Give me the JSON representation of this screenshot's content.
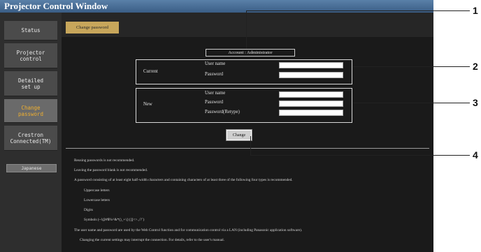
{
  "window": {
    "title": "Projector Control Window"
  },
  "sidebar": {
    "items": [
      {
        "label": "Status"
      },
      {
        "label": "Projector\ncontrol"
      },
      {
        "label": "Detailed\nset up"
      },
      {
        "label": "Change\npassword"
      },
      {
        "label": "Crestron\nConnected(TM)"
      }
    ],
    "language": "Japanese"
  },
  "tabs": {
    "change_password": "Change password"
  },
  "account": {
    "label": "Account : Administrator"
  },
  "current": {
    "label": "Current",
    "user_name_label": "User name",
    "password_label": "Password",
    "user_name_value": "",
    "password_value": ""
  },
  "new": {
    "label": "New",
    "user_name_label": "User name",
    "password_label": "Password",
    "retype_label": "Password(Retype)",
    "user_name_value": "",
    "password_value": "",
    "retype_value": ""
  },
  "change_button": "Change",
  "notes": [
    "Reusing passwords is not recommended.",
    "Leaving the password blank is not recommended.",
    "A password consisting of at least eight half-width characters and containing characters of at least three of the following four types is recommended.",
    "Uppercase letters",
    "Lowercase letters",
    "Digits",
    "Symbols (~!@#$%^&*()_+\\|}{][<>.,/?`)",
    "The user name and password are used by the Web Control function and for communication control via a LAN (including Panasonic application software).",
    "Changing the current settings may interrupt the connection. For details, refer to the user's manual."
  ],
  "callouts": [
    "1",
    "2",
    "3",
    "4"
  ]
}
